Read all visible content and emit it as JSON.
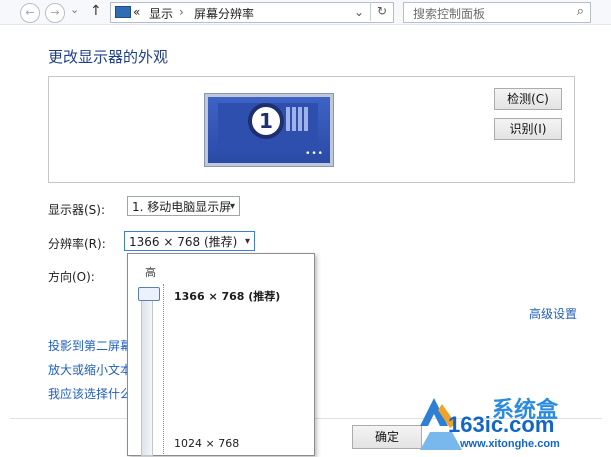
{
  "nav": {
    "back_icon": "←",
    "forward_icon": "→",
    "dropdown_icon": "⌄",
    "up_icon": "↑"
  },
  "address": {
    "overflow": "«",
    "crumbs": [
      "显示",
      "屏幕分辨率"
    ],
    "sep": "›",
    "dropdown": "⌄"
  },
  "search": {
    "placeholder": "搜索控制面板"
  },
  "page": {
    "title": "更改显示器的外观"
  },
  "preview": {
    "monitor_number": "1",
    "detect_label": "检测(C)",
    "identify_label": "识别(I)"
  },
  "settings": {
    "display_label": "显示器(S):",
    "display_value": "1. 移动电脑显示屏",
    "resolution_label": "分辨率(R):",
    "resolution_value": "1366 × 768 (推荐)",
    "orientation_label": "方向(O):"
  },
  "resolution_popup": {
    "high_label": "高",
    "options": [
      "1366 × 768 (推荐)",
      "1024 × 768"
    ],
    "selected_fraction": 1.0
  },
  "links": {
    "advanced": "高级设置",
    "project": "投影到第二屏幕",
    "enlarge": "放大或缩小文本",
    "choose": "我应该选择什么"
  },
  "footer": {
    "ok_label": "确定"
  },
  "watermark": {
    "brand": "系统盒",
    "domain": "163ic.com",
    "url": "www.xitonghe.com"
  },
  "colors": {
    "link": "#1f5fbf",
    "title": "#1f3f8c",
    "monitor": "#2f4fae"
  }
}
